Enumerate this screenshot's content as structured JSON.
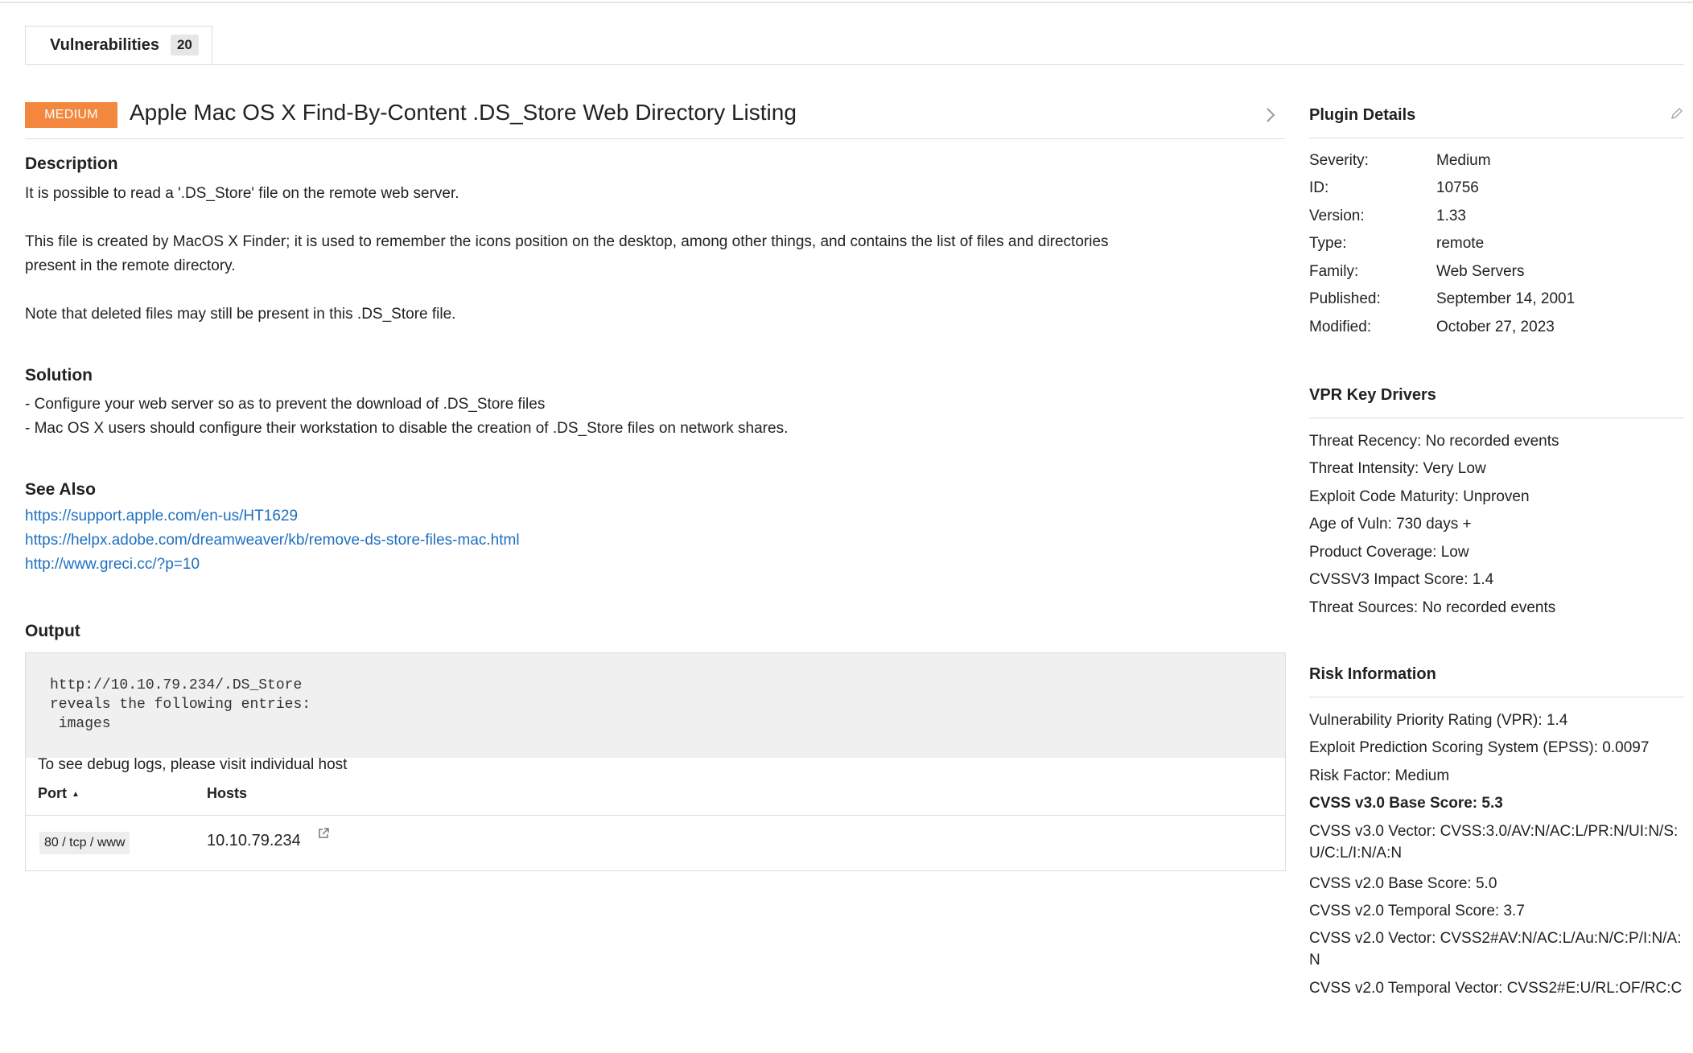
{
  "tabs": [
    {
      "label": "Vulnerabilities",
      "count": "20"
    }
  ],
  "vulnerability": {
    "severity": "MEDIUM",
    "title": "Apple Mac OS X Find-By-Content .DS_Store Web Directory Listing"
  },
  "description": {
    "heading": "Description",
    "paragraphs": [
      "It is possible to read a '.DS_Store' file on the remote web server.",
      "This file is created by MacOS X Finder; it is used to remember the icons position on the desktop, among other things, and contains the list of files and directories present in the remote directory.",
      "Note that deleted files may still be present in this .DS_Store file."
    ]
  },
  "solution": {
    "heading": "Solution",
    "lines": [
      "- Configure your web server so as to prevent the download of .DS_Store files",
      "- Mac OS X users should configure their workstation to disable the creation of .DS_Store files on network shares."
    ]
  },
  "see_also": {
    "heading": "See Also",
    "links": [
      "https://support.apple.com/en-us/HT1629",
      "https://helpx.adobe.com/dreamweaver/kb/remove-ds-store-files-mac.html",
      "http://www.greci.cc/?p=10"
    ]
  },
  "output": {
    "heading": "Output",
    "text": "http://10.10.79.234/.DS_Store\nreveals the following entries:\n images",
    "debug_note": "To see debug logs, please visit individual host",
    "columns": {
      "port": "Port",
      "hosts": "Hosts"
    },
    "rows": [
      {
        "port": "80 / tcp / www",
        "host": "10.10.79.234"
      }
    ]
  },
  "plugin_details": {
    "heading": "Plugin Details",
    "rows": [
      {
        "label": "Severity:",
        "value": "Medium"
      },
      {
        "label": "ID:",
        "value": "10756"
      },
      {
        "label": "Version:",
        "value": "1.33"
      },
      {
        "label": "Type:",
        "value": "remote"
      },
      {
        "label": "Family:",
        "value": "Web Servers"
      },
      {
        "label": "Published:",
        "value": "September 14, 2001"
      },
      {
        "label": "Modified:",
        "value": "October 27, 2023"
      }
    ]
  },
  "vpr_key_drivers": {
    "heading": "VPR Key Drivers",
    "lines": [
      "Threat Recency: No recorded events",
      "Threat Intensity: Very Low",
      "Exploit Code Maturity: Unproven",
      "Age of Vuln: 730 days +",
      "Product Coverage: Low",
      "CVSSV3 Impact Score: 1.4",
      "Threat Sources: No recorded events"
    ]
  },
  "risk_information": {
    "heading": "Risk Information",
    "lines": [
      "Vulnerability Priority Rating (VPR): 1.4",
      "Exploit Prediction Scoring System (EPSS): 0.0097",
      "Risk Factor: Medium",
      "CVSS v3.0 Base Score: 5.3",
      "CVSS v3.0 Vector: CVSS:3.0/AV:N/AC:L/PR:N/UI:N/S:U/C:L/I:N/A:N",
      "CVSS v2.0 Base Score: 5.0",
      "CVSS v2.0 Temporal Score: 3.7",
      "CVSS v2.0 Vector: CVSS2#AV:N/AC:L/Au:N/C:P/I:N/A:N",
      "CVSS v2.0 Temporal Vector: CVSS2#E:U/RL:OF/RC:C"
    ]
  },
  "colors": {
    "severity_medium": "#f3873d",
    "link": "#1f6fbf",
    "output_bg": "#f0f0f0"
  }
}
